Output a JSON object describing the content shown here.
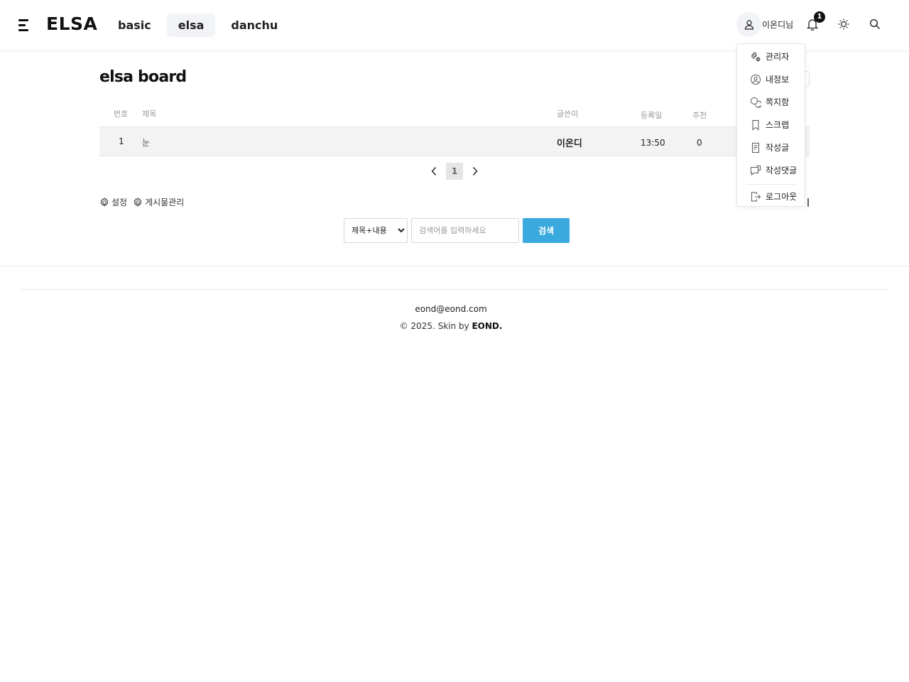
{
  "header": {
    "logo": "ELSA",
    "nav": [
      {
        "label": "basic",
        "active": false
      },
      {
        "label": "elsa",
        "active": true
      },
      {
        "label": "danchu",
        "active": false
      }
    ],
    "user_name": "이온디님",
    "notification_count": "1"
  },
  "board": {
    "title": "elsa board",
    "columns": {
      "no": "번호",
      "subject": "제목",
      "author": "글쓴이",
      "date": "등록일",
      "likes": "추천"
    },
    "rows": [
      {
        "no": "1",
        "subject": "눈",
        "author": "이온디",
        "date": "13:50",
        "likes": "0"
      }
    ],
    "pagination": {
      "current": "1"
    },
    "tools": {
      "settings": "설정",
      "manage": "게시물관리"
    }
  },
  "search": {
    "select_value": "제목+내용",
    "placeholder": "검색어를 입력하세요",
    "button": "검색"
  },
  "dropdown": {
    "items": [
      {
        "icon": "gear-cog-icon",
        "label": "관리자"
      },
      {
        "icon": "user-circle-icon",
        "label": "내정보"
      },
      {
        "icon": "message-icon",
        "label": "쪽지함"
      },
      {
        "icon": "bookmark-icon",
        "label": "스크랩"
      },
      {
        "icon": "document-icon",
        "label": "작성글"
      },
      {
        "icon": "comment-icon",
        "label": "작성댓글"
      },
      {
        "icon": "logout-icon",
        "label": "로그아웃"
      }
    ]
  },
  "footer": {
    "email": "eond@eond.com",
    "copy_prefix": "© 2025. Skin by ",
    "copy_brand": "EOND."
  },
  "colors": {
    "accent": "#3aa9dd",
    "text": "#222222",
    "row_bg": "#f3f3f3"
  }
}
